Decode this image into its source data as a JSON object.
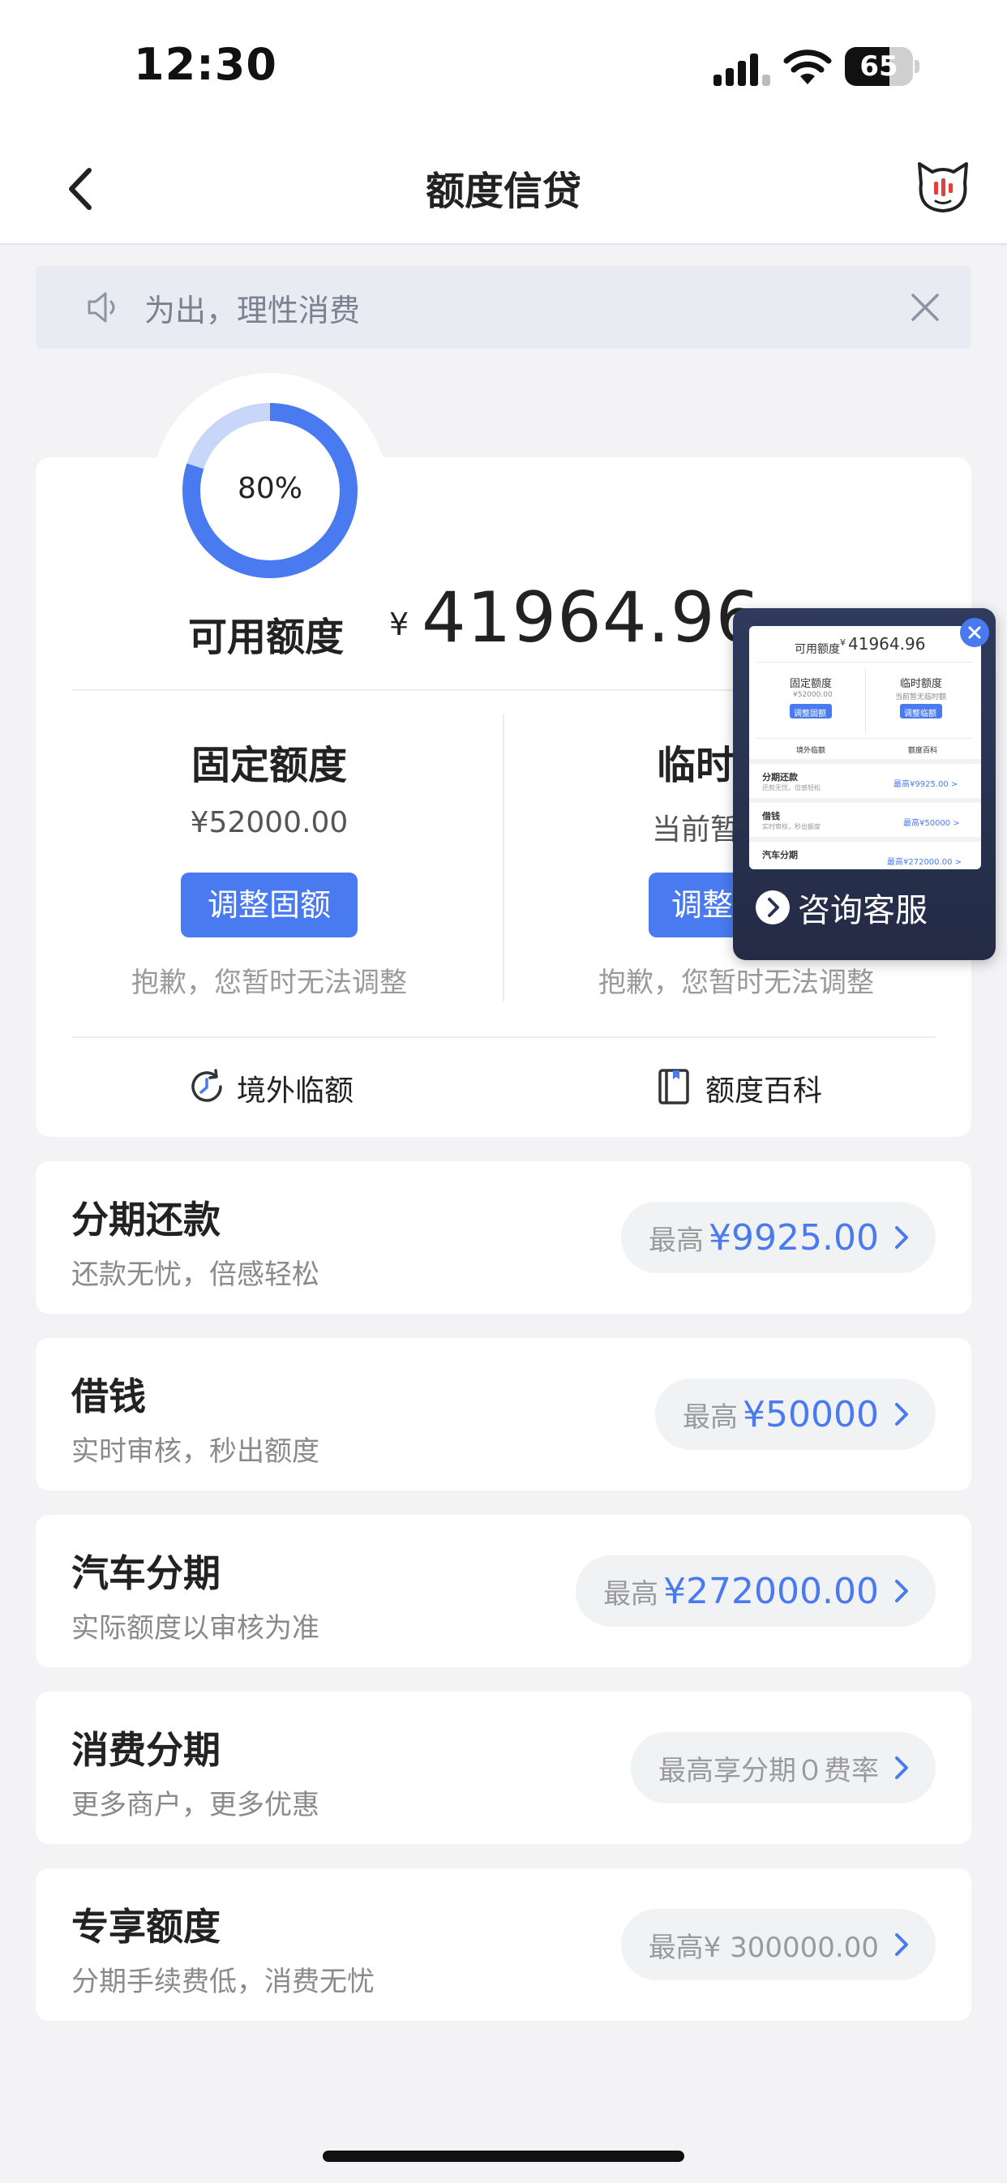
{
  "status_bar": {
    "time": "12:30",
    "battery": "65",
    "battery_level": 0.65
  },
  "nav": {
    "title": "额度信贷",
    "back_icon": "chevron-left-icon",
    "mascot_icon": "cat-mascot-icon"
  },
  "notice": {
    "text": "为出，理性消费",
    "icon": "speaker-icon",
    "close_icon": "close-icon"
  },
  "credit": {
    "usage_percent": 80,
    "usage_label": "80%",
    "available_label": "可用额度",
    "currency_symbol": "¥",
    "available_amount": "41964.96",
    "fixed": {
      "title": "固定额度",
      "amount": "¥52000.00",
      "button": "调整固额",
      "note": "抱歉，您暂时无法调整"
    },
    "temp": {
      "title": "临时",
      "amount": "当前暂",
      "button": "调整",
      "note": "抱歉，您暂时无法调整"
    },
    "links": [
      {
        "label": "境外临额",
        "icon": "refresh-clock-icon"
      },
      {
        "label": "额度百科",
        "icon": "book-icon"
      }
    ]
  },
  "float_widget": {
    "label": "咨询客服",
    "preview": {
      "amount": "41964.96",
      "currency": "¥",
      "available": "可用额度",
      "fixed": "固定额度",
      "temp": "临时额度",
      "fixed_amount": "¥52000.00",
      "temp_amount": "当前暂无临时额",
      "fixed_btn": "调整固额",
      "temp_btn": "调整临额",
      "link1": "境外临额",
      "link2": "额度百科",
      "row1_title": "分期还款",
      "row1_sub": "还款无忧，倍感轻松",
      "row1_val": "最高¥9925.00 >",
      "row2_title": "借钱",
      "row2_sub": "实时审核，秒出额度",
      "row2_val": "最高¥50000 >",
      "row3_title": "汽车分期",
      "row3_val": "最高¥272000.00 >"
    }
  },
  "products": [
    {
      "title": "分期还款",
      "subtitle": "还款无忧，倍感轻松",
      "prefix": "最高",
      "value": "¥9925.00",
      "style": "highlight"
    },
    {
      "title": "借钱",
      "subtitle": "实时审核，秒出额度",
      "prefix": "最高",
      "value": "¥50000",
      "style": "highlight"
    },
    {
      "title": "汽车分期",
      "subtitle": "实际额度以审核为准",
      "prefix": "最高",
      "value": "¥272000.00",
      "style": "highlight"
    },
    {
      "title": "消费分期",
      "subtitle": "更多商户，更多优惠",
      "prefix": "最高享分期０费率",
      "value": "",
      "style": "plain"
    },
    {
      "title": "专享额度",
      "subtitle": "分期手续费低，消费无忧",
      "prefix": "最高¥ 300000.00",
      "value": "",
      "style": "plain"
    }
  ],
  "colors": {
    "accent": "#4a7af0",
    "ring_track": "#c8d6fa",
    "background": "#f3f3f5"
  }
}
